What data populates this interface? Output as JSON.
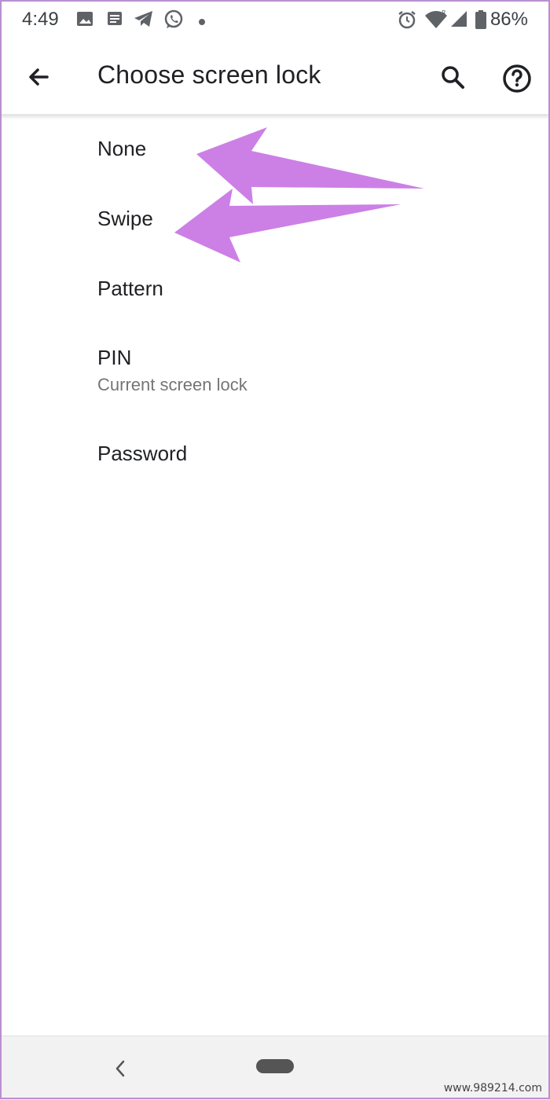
{
  "status_bar": {
    "time": "4:49",
    "battery": "86%",
    "icons": [
      "image-icon",
      "message-icon",
      "telegram-icon",
      "whatsapp-icon",
      "dot-icon",
      "alarm-icon",
      "wifi-icon",
      "signal-icon",
      "battery-icon"
    ]
  },
  "app_bar": {
    "title": "Choose screen lock",
    "icons": [
      "back-arrow-icon",
      "search-icon",
      "help-icon"
    ]
  },
  "options": [
    {
      "label": "None"
    },
    {
      "label": "Swipe"
    },
    {
      "label": "Pattern"
    },
    {
      "label": "PIN",
      "subtitle": "Current screen lock"
    },
    {
      "label": "Password"
    }
  ],
  "annotations": {
    "arrow_color": "#cc80e6",
    "arrow_targets": [
      "None",
      "Swipe"
    ]
  },
  "nav_bar": {
    "icons": [
      "nav-back-icon",
      "home-pill-icon"
    ]
  },
  "watermark": "www.989214.com",
  "colors": {
    "frame": "#b98fd1",
    "text_primary": "#202124",
    "text_secondary": "#757575"
  }
}
